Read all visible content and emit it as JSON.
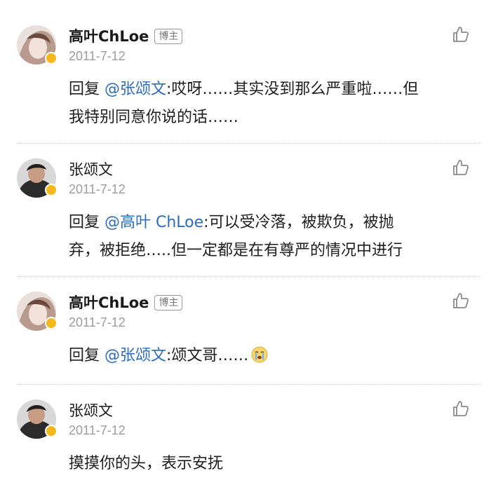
{
  "comments": [
    {
      "name": "高叶ChLoe",
      "tag": "博主",
      "date": "2011-7-12",
      "reply_prefix": "回复 ",
      "mention": "@张颂文",
      "text_line1": ":哎呀……其实没到那么严重啦……但",
      "text_line2": "我特别同意你说的话……"
    },
    {
      "name": "张颂文",
      "date": "2011-7-12",
      "reply_prefix": "回复 ",
      "mention": "@高叶 ChLoe",
      "text_line1": ":可以受冷落，被欺负，被抛",
      "text_line2": "弃，被拒绝…..但一定都是在有尊严的情况中进行"
    },
    {
      "name": "高叶ChLoe",
      "tag": "博主",
      "date": "2011-7-12",
      "reply_prefix": "回复 ",
      "mention": "@张颂文",
      "text_line1": ":颂文哥……",
      "emoji": "crying-emoji"
    },
    {
      "name": "张颂文",
      "date": "2011-7-12",
      "text_line1": "摸摸你的头，表示安抚"
    }
  ],
  "icons": {
    "like": "thumbs-up-outline-icon",
    "verified": "verified-badge-icon"
  },
  "colors": {
    "mention": "#2e6bb8",
    "date": "#9c9c9c",
    "badge": "#f5b91c"
  }
}
